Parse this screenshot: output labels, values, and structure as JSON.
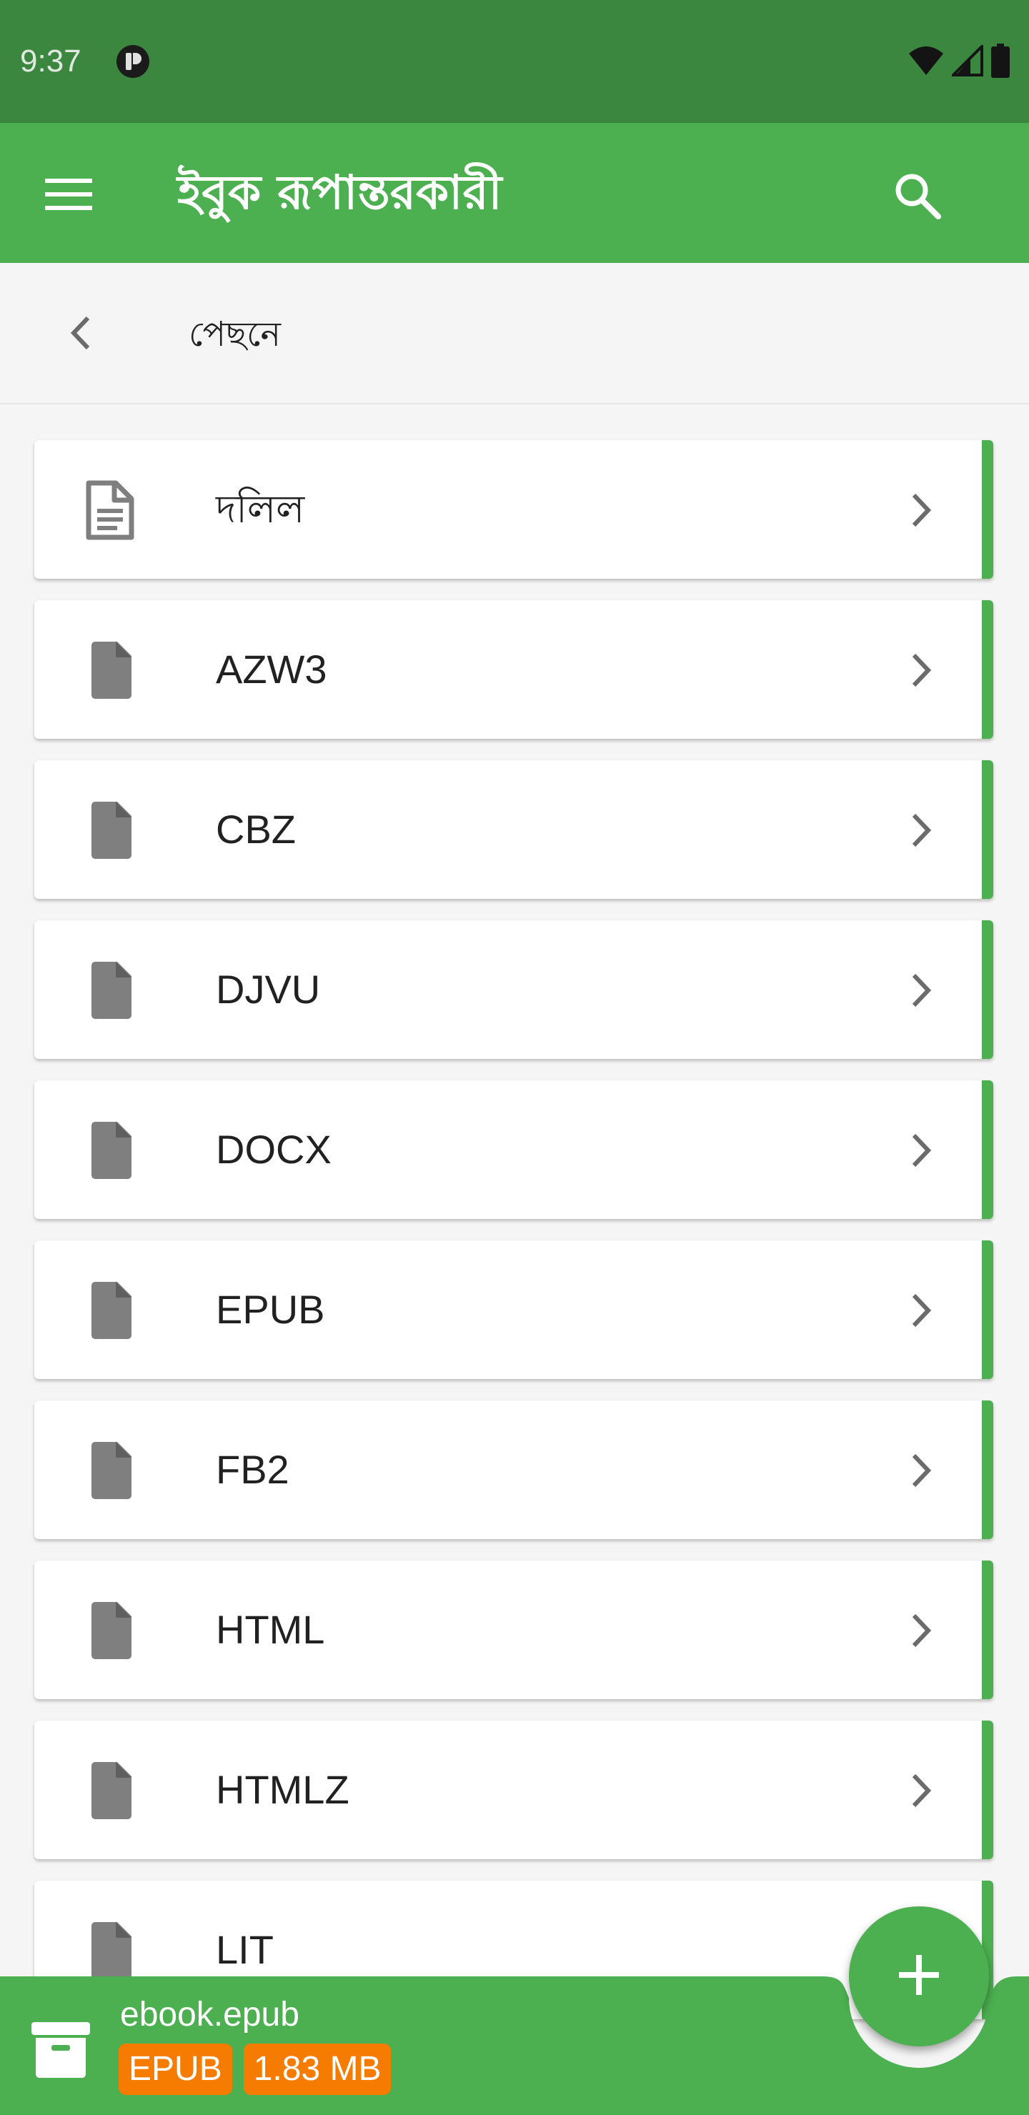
{
  "status_bar": {
    "time": "9:37",
    "icons": [
      "app-notification-icon",
      "wifi-icon",
      "signal-icon",
      "battery-icon"
    ]
  },
  "app_bar": {
    "title": "ইবুক রূপান্তরকারী",
    "menu_icon": "hamburger-menu-icon",
    "search_icon": "search-icon"
  },
  "back_row": {
    "label": "পেছনে",
    "icon": "chevron-left-icon"
  },
  "formats": [
    {
      "label": "দলিল",
      "icon": "document-outline-icon"
    },
    {
      "label": "AZW3",
      "icon": "file-icon"
    },
    {
      "label": "CBZ",
      "icon": "file-icon"
    },
    {
      "label": "DJVU",
      "icon": "file-icon"
    },
    {
      "label": "DOCX",
      "icon": "file-icon"
    },
    {
      "label": "EPUB",
      "icon": "file-icon"
    },
    {
      "label": "FB2",
      "icon": "file-icon"
    },
    {
      "label": "HTML",
      "icon": "file-icon"
    },
    {
      "label": "HTMLZ",
      "icon": "file-icon"
    },
    {
      "label": "LIT",
      "icon": "file-icon"
    }
  ],
  "bottom_bar": {
    "file_name": "ebook.epub",
    "file_type": "EPUB",
    "file_size": "1.83 MB",
    "icon": "archive-box-icon"
  },
  "fab": {
    "icon": "plus-icon"
  },
  "colors": {
    "primary": "#4caf50",
    "primary_dark": "#3b873f",
    "badge": "#f57c00",
    "icon_gray": "#7f7f7f"
  }
}
